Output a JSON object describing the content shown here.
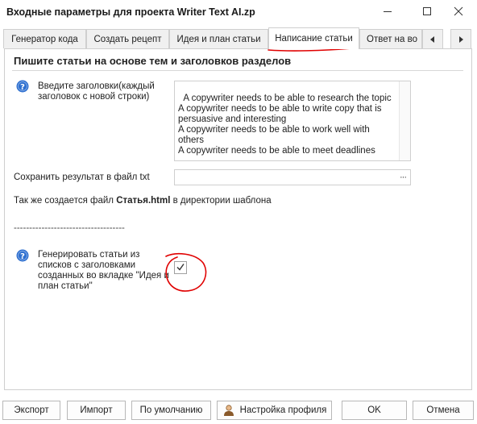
{
  "window": {
    "title": "Входные параметры для проекта Writer Text AI.zp",
    "minimize_icon": "minimize-icon",
    "maximize_icon": "maximize-icon",
    "close_icon": "close-icon"
  },
  "tabs": [
    {
      "label": "Генератор кода"
    },
    {
      "label": "Создать рецепт"
    },
    {
      "label": "Идея и план статьи"
    },
    {
      "label": "Написание статьи",
      "active": true
    },
    {
      "label": "Ответ на во"
    }
  ],
  "panel": {
    "header": "Пишите статьи на основе тем и заголовков разделов",
    "headings_label": "Введите заголовки(каждый\nзаголовок с новой строки)",
    "headings_value": "A copywriter needs to be able to research the topic\nA copywriter needs to be able to write copy that is persuasive and interesting\nA copywriter needs to be able to work well with others\nA copywriter needs to be able to meet deadlines",
    "save_label": "Сохранить результат в файл txt",
    "save_value": "",
    "browse_label": "···",
    "note_prefix": "Так же создается файл ",
    "note_bold": "Статья.html",
    "note_suffix": " в директории шаблона",
    "separator": "------------------------------------",
    "generate_label": "Генерировать статьи из\nсписков с заголовками\nсозданных во вкладке \"Идея и\nплан статьи\"",
    "generate_checked": true
  },
  "buttons": {
    "export": "Экспорт",
    "import": "Импорт",
    "default": "По умолчанию",
    "profile": "Настройка профиля",
    "ok": "OK",
    "cancel": "Отмена"
  },
  "colors": {
    "help_icon": "#2d6fd0",
    "annotation": "#e00000"
  }
}
